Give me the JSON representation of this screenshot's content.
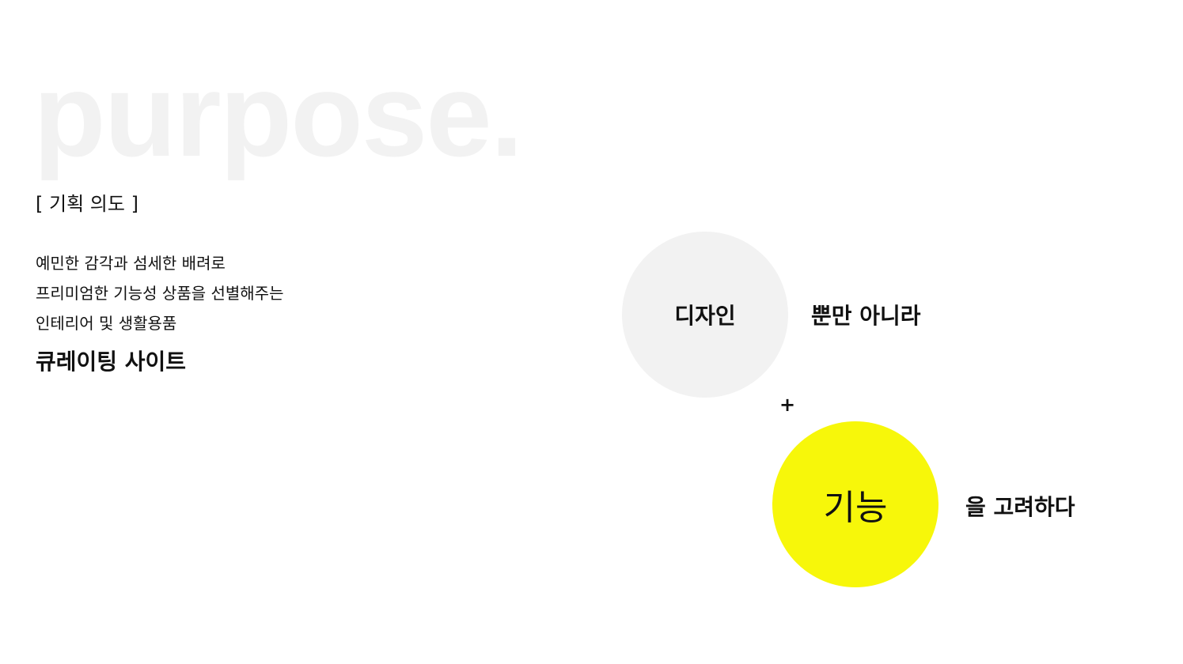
{
  "background_word": "purpose.",
  "section_label": "[ 기획 의도 ]",
  "description_lines": [
    "예민한 감각과 섬세한 배려로",
    "프리미엄한 기능성 상품을 선별해주는",
    "인테리어 및 생활용품"
  ],
  "headline": "큐레이팅 사이트",
  "diagram": {
    "circle_design": "디자인",
    "text_after_design": "뿐만 아니라",
    "connector": "+",
    "circle_function": "기능",
    "text_after_function": "을 고려하다"
  },
  "colors": {
    "background_word": "#f2f2f2",
    "circle_design": "#f2f2f2",
    "circle_function": "#f7f70a",
    "text": "#111111"
  }
}
